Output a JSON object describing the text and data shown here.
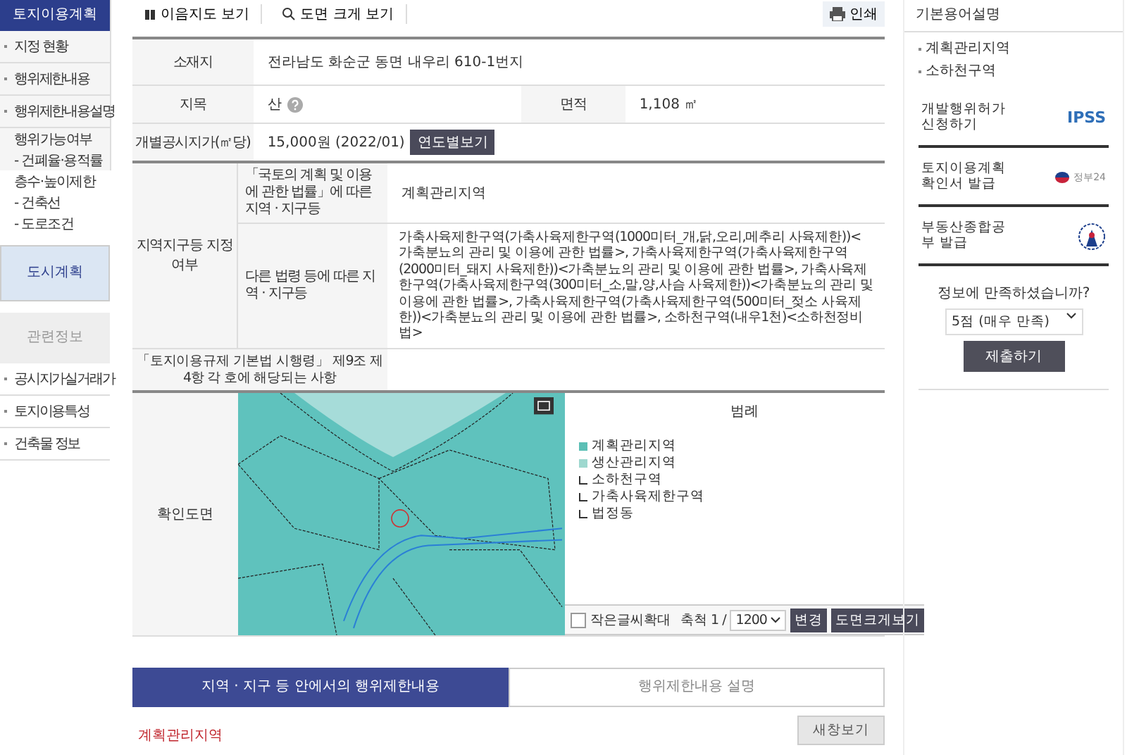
{
  "sidebar": {
    "title": "토지이용계획",
    "items": [
      {
        "kind": "item",
        "label": "지정 현황",
        "selected": false
      },
      {
        "kind": "item",
        "label": "행위제한내용",
        "selected": false
      },
      {
        "kind": "item",
        "label": "행위제한내용설명",
        "selected": false
      },
      {
        "kind": "sub",
        "label": "행위가능여부",
        "selected": false
      },
      {
        "kind": "sub",
        "label": "- 건폐율·용적률",
        "selected": false
      },
      {
        "kind": "sub",
        "label": "층수·높이제한",
        "selected": false
      },
      {
        "kind": "sub",
        "label": "- 건축선",
        "selected": false
      },
      {
        "kind": "sub",
        "label": "- 도로조건",
        "selected": false
      },
      {
        "kind": "section",
        "label": "도시계획",
        "selected": true
      },
      {
        "kind": "section",
        "label": "관련정보",
        "selected": false
      },
      {
        "kind": "item",
        "label": "공시지가실거래가",
        "selected": false
      },
      {
        "kind": "item",
        "label": "토지이용특성",
        "selected": false
      },
      {
        "kind": "item",
        "label": "건축물 정보",
        "selected": false
      }
    ]
  },
  "toolbar": {
    "buttons": [
      "이음지도 보기",
      "도면 크게 보기"
    ],
    "print": "인쇄"
  },
  "info_table": {
    "address": {
      "label": "소재지",
      "value": "전라남도 화순군 동면 내우리 610-1번지"
    },
    "land_category": {
      "label": "지목",
      "value": "산"
    },
    "area": {
      "label": "면적",
      "value": "1,108 ㎡"
    },
    "price": {
      "label": "개별공시지가(㎡당)",
      "value": "15,000원 (2022/01)",
      "button": "연도별보기"
    },
    "zoning": {
      "label": "지역지구등 지정여부",
      "rows": [
        {
          "label": "「국토의 계획 및 이용에 관한 법률」에 따른 지역 · 지구등",
          "value": "계획관리지역"
        },
        {
          "label": "다른 법령 등에 따른 지역 · 지구등",
          "value": "가축사육제한구역(가축사육제한구역(1000미터_개,닭,오리,메추리 사육제한))<가축분뇨의 관리 및 이용에 관한 법률>, 가축사육제한구역(가축사육제한구역(2000미터_돼지 사육제한))<가축분뇨의 관리 및 이용에 관한 법률>, 가축사육제한구역(가축사육제한구역(300미터_소,말,양,사슴 사육제한))<가축분뇨의 관리 및 이용에 관한 법률>, 가축사육제한구역(가축사육제한구역(500미터_젖소 사육제한))<가축분뇨의 관리 및 이용에 관한 법률>, 소하천구역(내우1천)<소하천정비법>"
        }
      ]
    },
    "decree": {
      "label": "「토지이용규제 기본법 시행령」 제9조 제4항 각 호에 해당되는 사항"
    },
    "map": {
      "label": "확인도면",
      "legend_title": "범례",
      "legend": [
        {
          "kind": "fill",
          "label": "계획관리지역",
          "color": "#5bbfb5"
        },
        {
          "kind": "fill",
          "label": "생산관리지역",
          "color": "#9ed8cf"
        },
        {
          "kind": "outline",
          "label": "소하천구역"
        },
        {
          "kind": "outline",
          "label": "가축사육제한구역"
        },
        {
          "kind": "outline",
          "label": "법정동"
        }
      ],
      "enlarge_text": {
        "label": "작은글씨확대",
        "checked": false
      },
      "scale_label": "축척 1 /",
      "scale_value": "1200",
      "change_button": "변경",
      "big_button": "도면크게보기"
    }
  },
  "tabs": [
    {
      "label": "지역 · 지구 등 안에서의 행위제한내용",
      "selected": true
    },
    {
      "label": "행위제한내용 설명",
      "selected": false
    }
  ],
  "restriction": {
    "title": "계획관리지역",
    "button": "새창보기"
  },
  "right_panel": {
    "title": "기본용어설명",
    "terms": [
      "계획관리지역",
      "소하천구역"
    ],
    "services": [
      {
        "label": "개발행위허가 신청하기",
        "logo": "IPSS"
      },
      {
        "label": "토지이용계획 확인서 발급",
        "logo": "정부24"
      },
      {
        "label": "부동산종합공부 발급"
      }
    ],
    "survey": {
      "question": "정보에 만족하셨습니까?",
      "value": "5점 (매우 만족)",
      "submit": "제출하기"
    }
  }
}
